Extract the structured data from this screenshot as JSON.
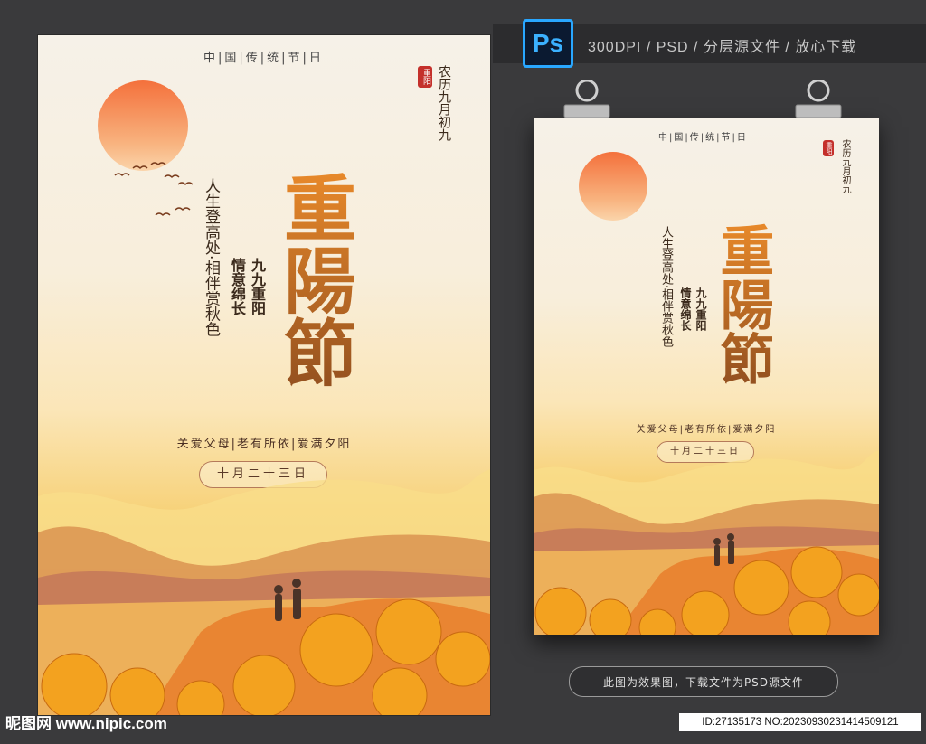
{
  "banner": {
    "app_icon_label": "Ps",
    "text": "300DPI / PSD / 分层源文件 / 放心下载"
  },
  "poster": {
    "header": "中|国|传|统|节|日",
    "seal_text": "重阳",
    "date_vertical": "农历九月初九",
    "title": "重陽節",
    "slogan_left": "人生登高处·相伴赏秋色",
    "slogan_mid": "情意绵长",
    "slogan_right": "九九重阳",
    "tagline": "关爱父母|老有所依|爱满夕阳",
    "date_pill": "十月二十三日"
  },
  "caption": "此图为效果图，下载文件为PSD源文件",
  "watermark": "昵图网 www.nipic.com",
  "id_text": "ID:27135173 NO:20230930231414509121",
  "colors": {
    "background": "#3a3a3c",
    "accent_orange": "#d88a2a",
    "seal_red": "#c4302b",
    "ps_blue": "#29a7ff"
  }
}
